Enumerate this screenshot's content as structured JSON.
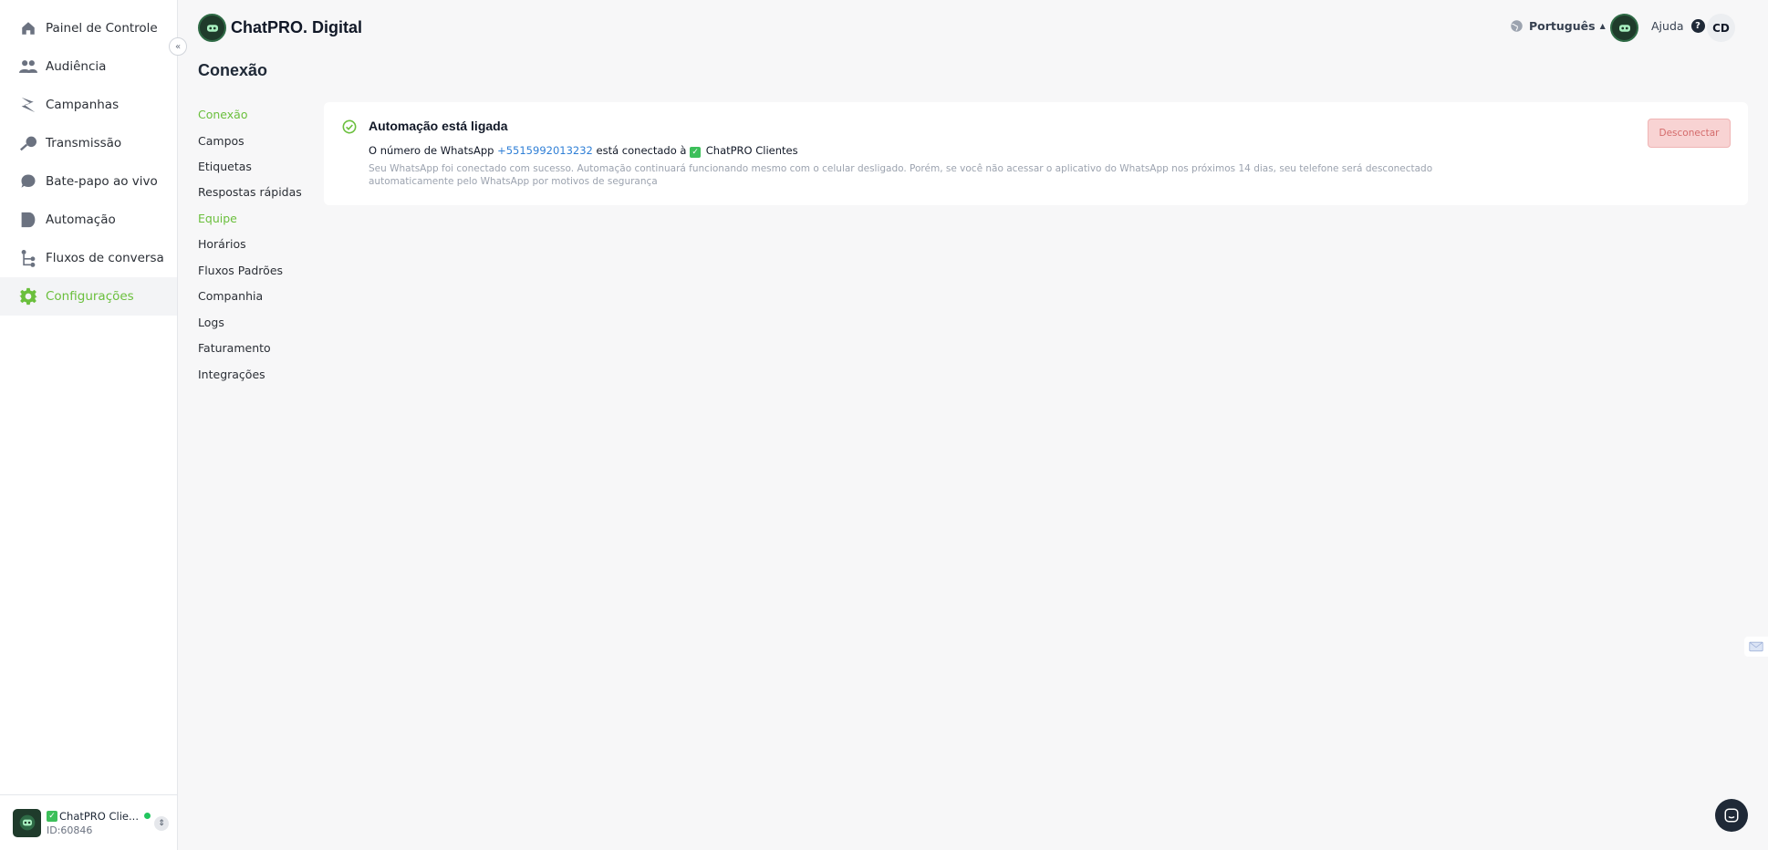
{
  "app": {
    "brand": "ChatPRO. Digital"
  },
  "sidebar": {
    "items": [
      {
        "label": "Painel de Controle",
        "icon": "home-icon"
      },
      {
        "label": "Audiência",
        "icon": "users-icon"
      },
      {
        "label": "Campanhas",
        "icon": "campaign-icon"
      },
      {
        "label": "Transmissão",
        "icon": "broadcast-icon"
      },
      {
        "label": "Bate-papo ao vivo",
        "icon": "chat-icon"
      },
      {
        "label": "Automação",
        "icon": "automation-icon"
      },
      {
        "label": "Fluxos de conversa",
        "icon": "flow-icon"
      },
      {
        "label": "Configurações",
        "icon": "gear-icon",
        "active": true
      }
    ],
    "account": {
      "name": "ChatPRO Clie...",
      "id": "ID:60846"
    }
  },
  "header": {
    "language": "Português",
    "help": "Ajuda",
    "user_initials": "CD"
  },
  "page": {
    "title": "Conexão"
  },
  "subnav": {
    "items": [
      {
        "label": "Conexão",
        "active": true
      },
      {
        "label": "Campos"
      },
      {
        "label": "Etiquetas"
      },
      {
        "label": "Respostas rápidas"
      },
      {
        "label": "Equipe",
        "highlight": true
      },
      {
        "label": "Horários"
      },
      {
        "label": "Fluxos Padrões"
      },
      {
        "label": "Companhia"
      },
      {
        "label": "Logs"
      },
      {
        "label": "Faturamento"
      },
      {
        "label": "Integrações"
      }
    ]
  },
  "connection": {
    "title": "Automação está ligada",
    "line_prefix": "O número de WhatsApp",
    "phone": "+5515992013232",
    "line_middle": "está conectado à",
    "account_name": "ChatPRO Clientes",
    "description": "Seu WhatsApp foi conectado com sucesso. Automação continuará funcionando mesmo com o celular desligado. Porém, se você não acessar o aplicativo do WhatsApp nos próximos 14 dias, seu telefone será desconectado automaticamente pelo WhatsApp por motivos de segurança",
    "disconnect_label": "Desconectar"
  },
  "colors": {
    "accent": "#6abf3c",
    "link": "#2f7fd6",
    "danger_bg": "#f8d3d3",
    "danger_text": "#d46b6b"
  }
}
